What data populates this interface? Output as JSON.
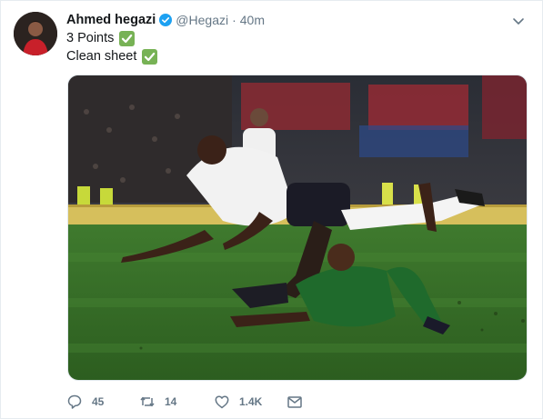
{
  "tweet": {
    "author_name": "Ahmed hegazi",
    "handle": "@Hegazi",
    "separator": "·",
    "time": "40m",
    "lines": [
      "3 Points",
      "Clean sheet"
    ],
    "media_icon": "football-match-photo",
    "actions": {
      "reply_count": "45",
      "retweet_count": "14",
      "like_count": "1.4K"
    }
  },
  "colors": {
    "accent": "#1da1f2",
    "check": "#77b255",
    "muted": "#657786"
  }
}
